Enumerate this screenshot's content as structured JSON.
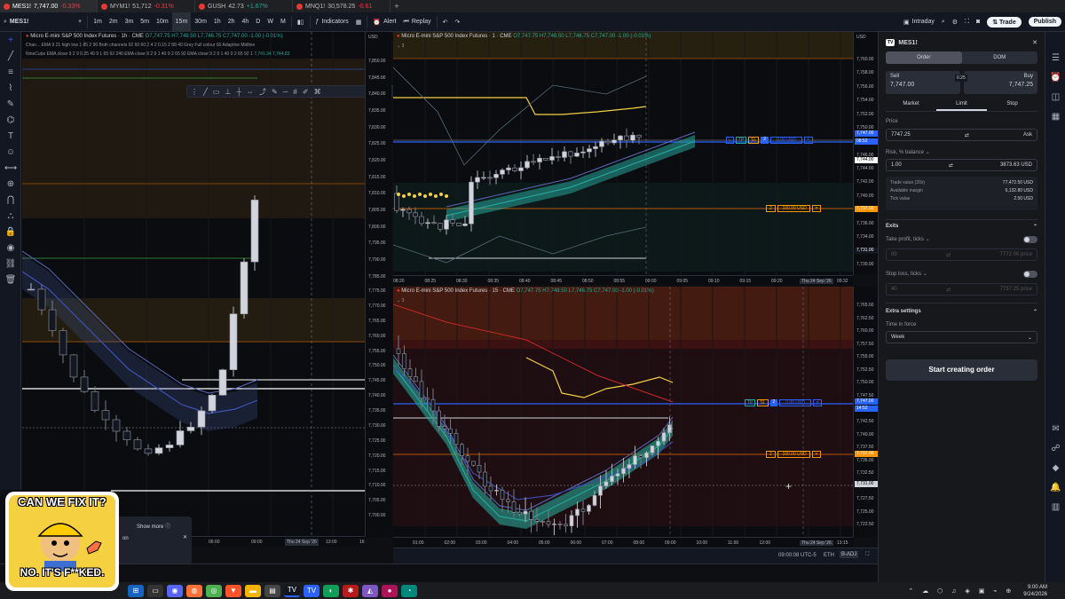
{
  "browser_tabs": [
    {
      "symbol": "MES1!",
      "price": "7,747.00",
      "change": "-0.33%",
      "dir": "neg",
      "active": true
    },
    {
      "symbol": "MYM1!",
      "price": "51,712",
      "change": "-0.31%",
      "dir": "neg",
      "active": false
    },
    {
      "symbol": "GUSH",
      "price": "42.73",
      "change": "+1.67%",
      "dir": "pos",
      "active": false
    },
    {
      "symbol": "MNQ1!",
      "price": "30,578.25",
      "change": "-0.61",
      "dir": "neg",
      "active": false
    }
  ],
  "toolbar": {
    "symbol": "MES1!",
    "intervals": [
      "1m",
      "2m",
      "3m",
      "5m",
      "10m",
      "15m",
      "30m",
      "1h",
      "2h",
      "4h",
      "D",
      "W",
      "M"
    ],
    "selected_interval": "15m",
    "indicators_label": "Indicators",
    "alert_label": "Alert",
    "replay_label": "Replay",
    "layout_label": "Intraday",
    "trade_label": "Trade",
    "publish_label": "Publish"
  },
  "left_tools": [
    "crosshair-icon",
    "trend-line-icon",
    "horizontal-lines-icon",
    "fib-icon",
    "brush-icon",
    "pattern-icon",
    "text-icon",
    "emoji-icon",
    "ruler-icon",
    "zoom-icon",
    "magnet-icon",
    "lock-draw-icon",
    "lock-icon",
    "eye-icon",
    "link-icon",
    "trash-icon"
  ],
  "pane_left": {
    "title": "Micro E-mini S&P 500 Index Futures · 1h · CME",
    "ohlc": "O7,747.75 H7,748.50 L7,746.75 C7,747.00 -1.00 (-0.01%)",
    "ind1": "Chan... EMA 9 21 high low 1 85 2 90 Both channels 92 60 60 2 4 2 0.15 2 88 40 Grey Full colour 60 Adaptive Midline",
    "ind2": "NineCube EMA close 9 2 9 0.25 40 9 1 65 92 240 EMA close 9 2 9 1 40 9 2 65 92 EMA close 9 2 9 1 40 9 2 65 92 1",
    "ind2_values": "7,741.34 7,744.83",
    "currency": "USD",
    "time_labels": [
      "06:00",
      "09:00",
      "Thu 24 Sep '26",
      "13:00",
      "16"
    ],
    "price_labels": [
      "7,747.00",
      "7,746.75",
      "7,731.00",
      "7,710.00"
    ],
    "popup_more": "Show more",
    "popup_text": "on"
  },
  "axis_left_prices": [
    "7,850.00",
    "7,845.00",
    "7,840.00",
    "7,835.00",
    "7,830.00",
    "7,825.00",
    "7,820.00",
    "7,815.00",
    "7,810.00",
    "7,805.00",
    "7,800.00",
    "7,795.00",
    "7,790.00",
    "7,785.00",
    "7,780.00",
    "7,775.00",
    "7,770.00",
    "7,765.00",
    "7,760.00",
    "7,755.00",
    "7,750.00",
    "7,745.00",
    "7,740.00",
    "7,735.00",
    "7,730.00",
    "7,725.00",
    "7,720.00",
    "7,715.00",
    "7,710.00",
    "7,705.00",
    "7,700.00"
  ],
  "pane_top": {
    "title": "Micro E-mini S&P 500 Index Futures · 1 · CME",
    "ohlc": "O7,747.75 H7,748.50 L7,746.75 C7,747.00 -1.00 (-0.01%)",
    "badge": "3",
    "currency": "USD",
    "time_labels": [
      "08:20",
      "08:25",
      "08:30",
      "08:35",
      "08:40",
      "08:45",
      "08:50",
      "08:55",
      "09:00",
      "09:05",
      "09:10",
      "09:15",
      "09:20",
      "Thu 24 Sep '26",
      "09:32"
    ],
    "prices": [
      "7,760.00",
      "7,758.00",
      "7,756.00",
      "7,754.00",
      "7,752.00",
      "7,750.00",
      "7,748.00",
      "7,746.00",
      "7,744.00",
      "7,742.00",
      "7,740.00",
      "7,738.00",
      "7,736.00",
      "7,734.00",
      "7,732.00",
      "7,730.00"
    ],
    "current_price": "7,747.00",
    "current_time": "08:52",
    "tp_order": {
      "label": "0.00 USD",
      "qty": "2"
    },
    "sl_order": {
      "label": "-100.00 USD",
      "qty": "2"
    },
    "tags": [
      "7,744.00",
      "7,741.00",
      "7,737.00",
      "7,731.00"
    ]
  },
  "pane_bottom": {
    "title": "Micro E-mini S&P 500 Index Futures · 15 · CME",
    "ohlc": "O7,747.75 H7,748.50 L7,746.75 C7,747.00 -1.00 (-0.01%)",
    "badge": "3",
    "time_labels": [
      "01:00",
      "02:00",
      "03:00",
      "04:00",
      "05:00",
      "06:00",
      "07:00",
      "08:00",
      "09:00",
      "10:00",
      "11:00",
      "12:00",
      "Thu 24 Sep '26",
      "13:15"
    ],
    "prices": [
      "7,765.00",
      "7,762.50",
      "7,760.00",
      "7,757.50",
      "7,755.00",
      "7,752.50",
      "7,750.00",
      "7,747.50",
      "7,745.00",
      "7,742.50",
      "7,740.00",
      "7,737.50",
      "7,735.00",
      "7,732.50",
      "7,730.00",
      "7,727.50",
      "7,725.00",
      "7,722.50"
    ],
    "current_price": "7,747.00",
    "current_time": "14:52",
    "tp_order": {
      "label": "0.00 USD",
      "qty": "2"
    },
    "sl_order": {
      "label": "-100.00 USD",
      "qty": "2"
    },
    "tags": [
      "7,744.00",
      "7,737.00",
      "7,731.00"
    ]
  },
  "axis_mid_prices": [
    "7,775.00",
    "7,770.00",
    "7,765.00",
    "7,760.00",
    "7,755.00",
    "7,750.00",
    "7,745.00",
    "7,740.00",
    "7,735.00",
    "7,730.00",
    "7,725.00",
    "7,720.00",
    "7,715.00",
    "7,710.00",
    "7,705.00",
    "7,700.00"
  ],
  "status_bar": {
    "time": "09:00:08 UTC-5",
    "session": "ETH",
    "adj": "B-ADJ"
  },
  "order_panel": {
    "symbol": "MES1!",
    "tab_order": "Order",
    "tab_dom": "DOM",
    "sell_label": "Sell",
    "sell_price": "7,747.00",
    "spread": "0.25",
    "buy_label": "Buy",
    "buy_price": "7,747.25",
    "type_tabs": [
      "Market",
      "Limit",
      "Stop"
    ],
    "selected_type": "Limit",
    "price_label": "Price",
    "price_value": "7747.25",
    "price_suffix": "Ask",
    "risk_label": "Risk, % balance",
    "risk_value": "1.00",
    "risk_suffix": "3873.63 USD",
    "trade_value_label": "Trade value (20x)",
    "trade_value": "77,472.50 USD",
    "margin_label": "Available margin",
    "margin_value": "6,132.80 USD",
    "tick_label": "Tick value",
    "tick_value": "2.50 USD",
    "exits_label": "Exits",
    "tp_label": "Take profit, ticks",
    "tp_value": "99",
    "tp_price": "7772.00 price",
    "sl_label": "Stop loss, ticks",
    "sl_value": "40",
    "sl_price": "7737.25 price",
    "extra_label": "Extra settings",
    "tif_label": "Time in force",
    "tif_value": "Week",
    "submit_label": "Start creating order"
  },
  "taskbar": {
    "time": "9:00 AM",
    "date": "9/24/2026"
  },
  "meme": {
    "line1": "CAN WE FIX IT?",
    "line2": "NO. IT'S F**KED."
  },
  "colors": {
    "up": "#26a69a",
    "down": "#ef5350",
    "accent": "#2962ff",
    "yellow": "#f5d142",
    "orange": "#ff9800"
  }
}
